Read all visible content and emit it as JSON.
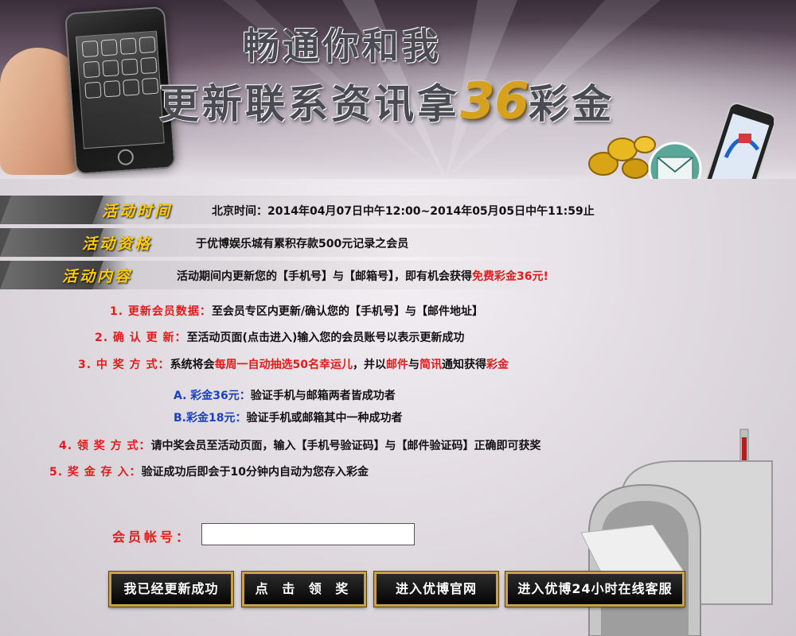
{
  "banner": {
    "title_line1": "畅通你和我",
    "title_line2": "更新联系资讯拿",
    "title_number": "36",
    "title_suffix": "彩金"
  },
  "sections": {
    "time": {
      "tag": "活动时间",
      "text": "北京时间：2014年04月07日中午12:00~2014年05月05日中午11:59止"
    },
    "eligibility": {
      "tag": "活动资格",
      "text": "于优博娱乐城有累积存款500元记录之会员"
    },
    "content": {
      "tag": "活动内容",
      "text_a": "活动期间内更新您的【手机号】与【邮箱号】，即有机会获得",
      "text_highlight": "免费彩金36元!"
    }
  },
  "rules": {
    "r1": {
      "label": "1. 更新会员数据：",
      "text": "至会员专区内更新/确认您的【手机号】与【邮件地址】"
    },
    "r2": {
      "label": "2. 确 认 更 新：",
      "text": "至活动页面(点击进入)输入您的会员账号以表示更新成功"
    },
    "r3": {
      "label": "3. 中 奖 方 式：",
      "t1": "系统将会",
      "h1": "每周一自动抽选50名幸运儿",
      "t2": "，并以",
      "h2": "邮件",
      "t3": "与",
      "h3": "简讯",
      "t4": "通知获得",
      "h4": "彩金"
    },
    "ra": {
      "label": "A. 彩金36元：",
      "text": "验证手机与邮箱两者皆成功者"
    },
    "rb": {
      "label": "B.彩金18元：",
      "text": "验证手机或邮箱其中一种成功者"
    },
    "r4": {
      "label": "4. 领 奖 方 式：",
      "text": "请中奖会员至活动页面，输入【手机号验证码】与【邮件验证码】正确即可获奖"
    },
    "r5": {
      "label": "5. 奖 金 存 入：",
      "text": "验证成功后即会于10分钟内自动为您存入彩金"
    }
  },
  "form": {
    "account_label": "会员帐号：",
    "account_value": "",
    "buttons": {
      "updated": "我已经更新成功",
      "claim": "点 击 领 奖",
      "official": "进入优博官网",
      "support": "进入优博24小时在线客服"
    }
  },
  "colors": {
    "tag_yellow": "#ffcc00",
    "highlight_red": "#e31b1b",
    "label_blue": "#1a3fbf",
    "button_border_gold": "#c8a24a"
  },
  "icons": [
    "phone-icon",
    "coins-icon",
    "envelope-icon",
    "mailbox-icon"
  ]
}
